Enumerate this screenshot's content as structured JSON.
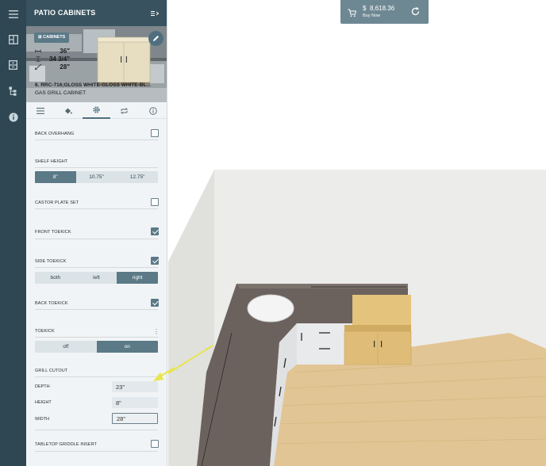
{
  "panel": {
    "title": "PATIO CABINETS",
    "hero": {
      "tag": "CABINETS",
      "width": "36\"",
      "height": "34 3/4\"",
      "depth": "28\"",
      "name": "6. RRC-716;GLOSS WHITE-GLOSS WHITE-BL...",
      "subtitle": "GAS GRILL CABINET"
    },
    "tabs": [
      "list-icon",
      "paint-bucket-icon",
      "gear-icon",
      "swap-icon",
      "info-icon"
    ],
    "active_tab": 2
  },
  "options": {
    "back_overhang": {
      "label": "BACK OVERHANG",
      "checked": false
    },
    "shelf_height": {
      "label": "SHELF HEIGHT",
      "options": [
        "8\"",
        "10.75\"",
        "12.75\""
      ],
      "selected": 0
    },
    "castor_plate_set": {
      "label": "CASTOR PLATE SET",
      "checked": false
    },
    "front_toekick": {
      "label": "FRONT TOEKICK",
      "checked": true
    },
    "side_toekick": {
      "label": "SIDE TOEKICK",
      "checked": true,
      "options": [
        "both",
        "left",
        "right"
      ],
      "selected": 2
    },
    "back_toekick": {
      "label": "BACK TOEKICK",
      "checked": true
    },
    "toekick": {
      "label": "TOEKICK",
      "options": [
        "off",
        "on"
      ],
      "selected": 1
    },
    "grill_cutout": {
      "label": "GRILL CUTOUT",
      "depth_label": "DEPTH",
      "depth_value": "23\"",
      "height_label": "HEIGHT",
      "height_value": "8\"",
      "width_label": "WIDTH",
      "width_value": "28\""
    },
    "tabletop_griddle": {
      "label": "TABLETOP GRIDDLE INSERT",
      "checked": false
    }
  },
  "pricebar": {
    "currency": "$",
    "amount": "8,618.36",
    "buy_label": "Buy Now"
  },
  "colors": {
    "rail": "#2f4752",
    "header": "#38535f",
    "accent": "#5b7987",
    "annotation_arrow": "#e8e54a"
  }
}
